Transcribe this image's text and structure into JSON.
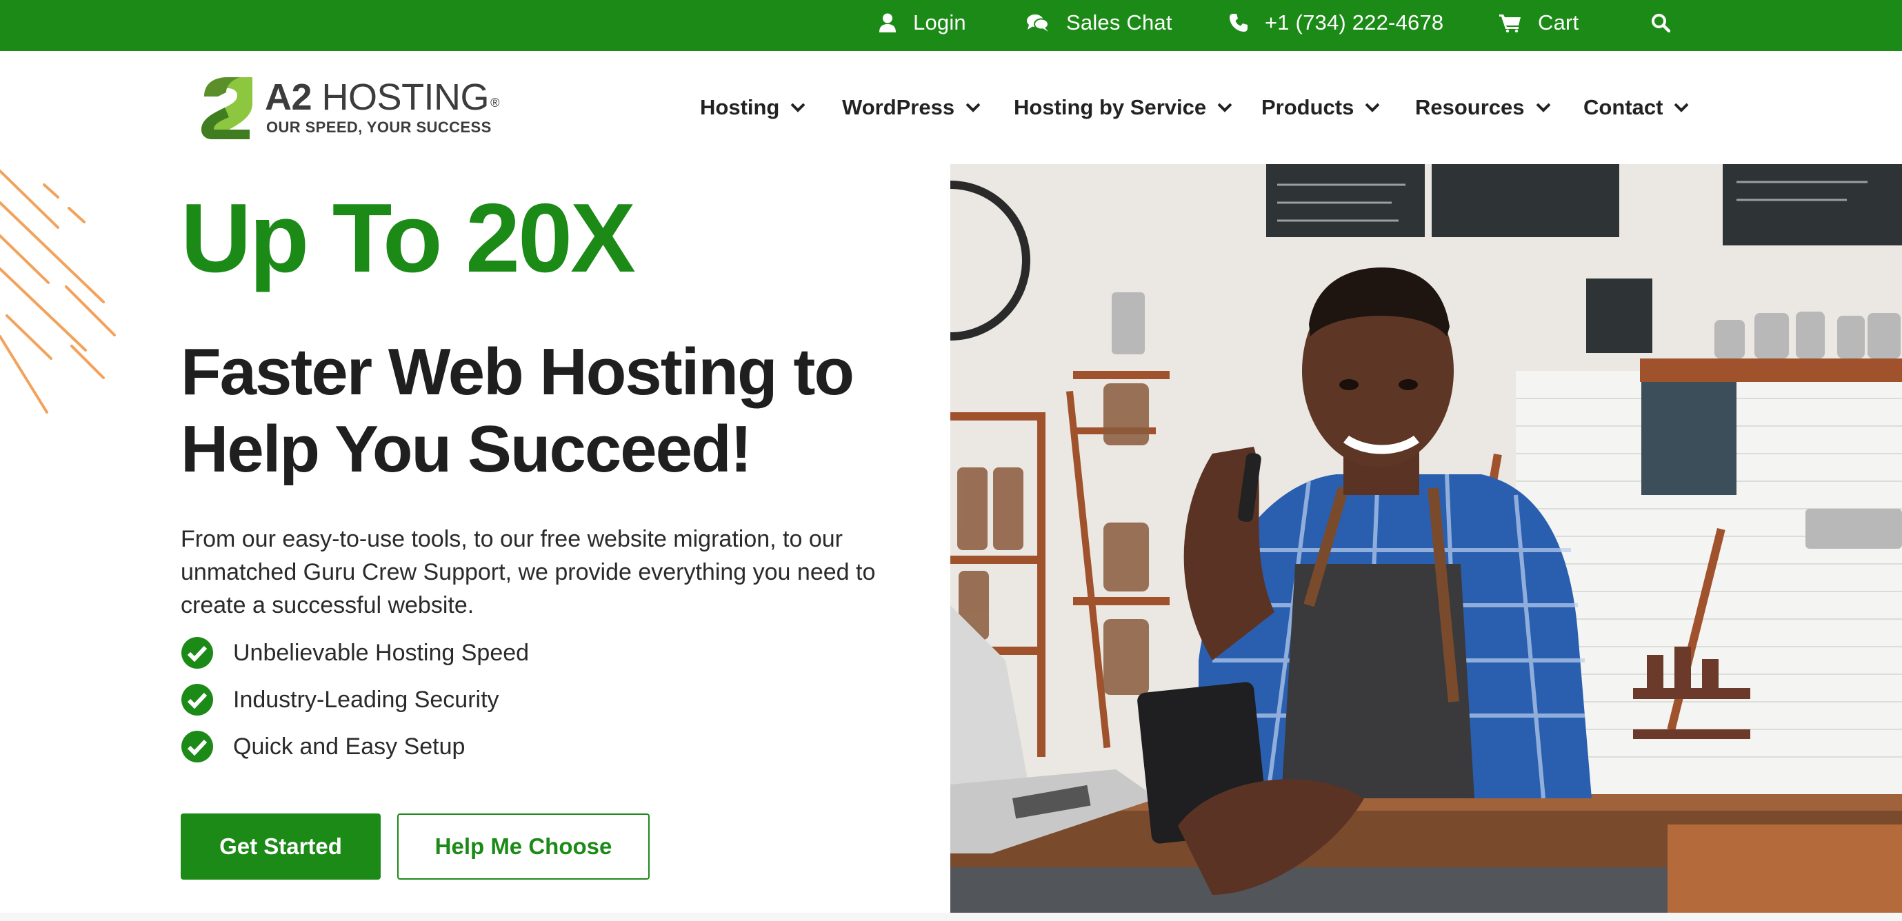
{
  "topbar": {
    "background": "#1c8a17",
    "items": [
      {
        "label": "Login",
        "icon": "user-icon"
      },
      {
        "label": "Sales Chat",
        "icon": "chat-bubbles-icon"
      },
      {
        "label": "+1 (734) 222-4678",
        "icon": "phone-icon"
      },
      {
        "label": "Cart",
        "icon": "cart-icon"
      }
    ],
    "search_icon": "search-icon"
  },
  "header": {
    "logo": {
      "brand": "A2",
      "name": "HOSTING",
      "registered": "®",
      "tagline": "OUR SPEED, YOUR SUCCESS"
    },
    "nav": [
      {
        "label": "Hosting"
      },
      {
        "label": "WordPress"
      },
      {
        "label": "Hosting by Service"
      },
      {
        "label": "Products"
      },
      {
        "label": "Resources"
      },
      {
        "label": "Contact"
      }
    ]
  },
  "hero": {
    "kicker": "Up To 20X",
    "title_line1": "Faster Web Hosting to",
    "title_line2": "Help You Succeed!",
    "description": "From our easy-to-use tools, to our free website migration, to our unmatched Guru Crew Support, we provide everything you need to create a successful website.",
    "features": [
      "Unbelievable Hosting Speed",
      "Industry-Leading Security",
      "Quick and Easy Setup"
    ],
    "primary_button": "Get Started",
    "secondary_button": "Help Me Choose"
  },
  "colors": {
    "brand_green": "#1c8a17",
    "accent_orange": "#f2a25a",
    "text_dark": "#1f1f1f"
  }
}
